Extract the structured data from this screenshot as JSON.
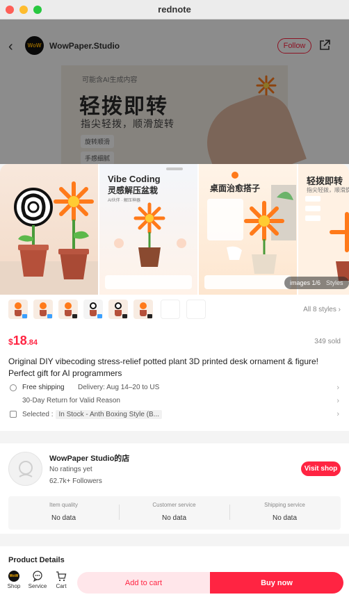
{
  "window": {
    "title": "rednote"
  },
  "post": {
    "author": "WowPaper.Studio",
    "avatar_text": "WoW",
    "follow_label": "Follow",
    "poster": {
      "ai_note": "可能含AI生成内容",
      "headline": "轻拨即转",
      "subline": "指尖轻拨，顺滑旋转",
      "chip1": "旋转顺滑",
      "chip2": "手感细腻"
    }
  },
  "gallery": {
    "slide2": {
      "title": "Vibe Coding",
      "subtitle": "灵感解压盆栽",
      "note": "AI伙伴 · 解压神器"
    },
    "slide3": {
      "title": "桌面治愈搭子"
    },
    "slide4": {
      "title": "轻拨即转",
      "subtitle": "指尖轻拨，顺滑旋转"
    },
    "badge_count": "images 1/6",
    "badge_styles": "Styles"
  },
  "thumbs": {
    "all_styles": "All 8 styles"
  },
  "product": {
    "currency": "$",
    "price_int": "18",
    "price_dec": ".84",
    "sold": "349 sold",
    "title": "Original DIY vibecoding stress-relief potted plant  3D printed desk ornament & figure! Perfect gift for AI programmers",
    "shipping_label": "Free shipping",
    "delivery": "Delivery: Aug 14–20 to US",
    "returns": "30-Day Return for Valid Reason",
    "selected_label": "Selected :",
    "selected_value": "In Stock - Anth Boxing Style (B..."
  },
  "shop": {
    "name": "WowPaper Studio的店",
    "rating": "No ratings yet",
    "followers": "62.7k+ Followers",
    "visit_label": "Visit shop",
    "metrics": [
      {
        "label": "Item quality",
        "value": "No data"
      },
      {
        "label": "Customer service",
        "value": "No data"
      },
      {
        "label": "Shipping service",
        "value": "No data"
      }
    ]
  },
  "details": {
    "heading": "Product Details"
  },
  "bottom": {
    "shop_label": "Shop",
    "service_label": "Service",
    "cart_label": "Cart",
    "add_to_cart": "Add to cart",
    "buy_now": "Buy now"
  },
  "colors": {
    "accent": "#ff2442"
  }
}
